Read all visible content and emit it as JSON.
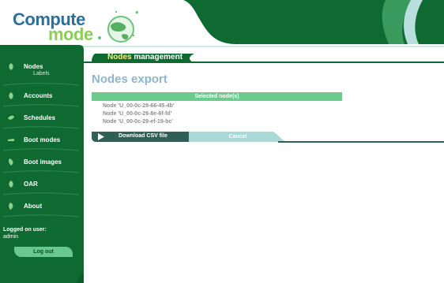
{
  "brand": {
    "logo_line1": "Compute",
    "logo_line2": "mode"
  },
  "sidebar": {
    "items": [
      {
        "label": "Nodes"
      },
      {
        "label": "Accounts"
      },
      {
        "label": "Schedules"
      },
      {
        "label": "Boot modes"
      },
      {
        "label": "Boot images"
      },
      {
        "label": "OAR"
      },
      {
        "label": "About"
      }
    ],
    "sub_item": "Labels",
    "logged_label": "Logged on user:",
    "logged_user": "admin",
    "logout_label": "Log out"
  },
  "section": {
    "highlight": "Nodes",
    "rest": " management"
  },
  "page_title": "Nodes export",
  "selected_header": "Selected node(s)",
  "nodes": [
    "Node 'U_00-0c-29-66-45-4b'",
    "Node 'U_00-0c-29-8e-6f-fd'",
    "Node 'U_00-0c-29-ef-19-bc'"
  ],
  "actions": {
    "download_label": "Download CSV file",
    "cancel_label": "Cancel"
  },
  "colors": {
    "dark_green": "#0f6a32",
    "light_green": "#6bcb8d",
    "teal": "#2f5f55",
    "light_teal": "#a9d8d6",
    "title_blue": "#8fb5ce"
  }
}
